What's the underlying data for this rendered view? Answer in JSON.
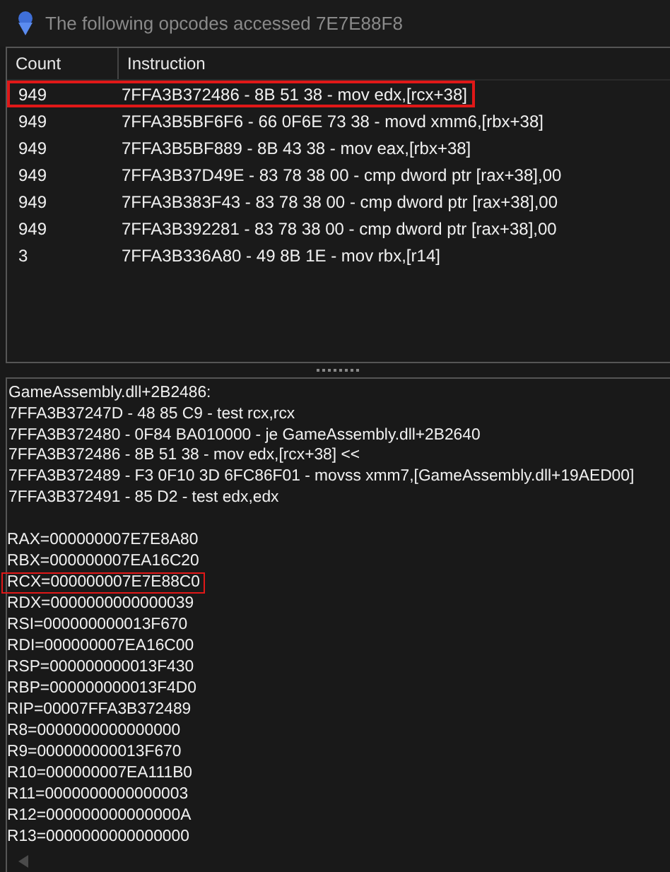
{
  "window": {
    "title": "The following opcodes accessed 7E7E88F8"
  },
  "table": {
    "columns": [
      "Count",
      "Instruction"
    ],
    "rows": [
      {
        "count": "949",
        "instruction": "7FFA3B372486 - 8B 51 38  - mov edx,[rcx+38]",
        "highlighted": true
      },
      {
        "count": "949",
        "instruction": "7FFA3B5BF6F6 - 66 0F6E 73 38  - movd xmm6,[rbx+38]",
        "highlighted": false
      },
      {
        "count": "949",
        "instruction": "7FFA3B5BF889 - 8B 43 38  - mov eax,[rbx+38]",
        "highlighted": false
      },
      {
        "count": "949",
        "instruction": "7FFA3B37D49E - 83 78 38 00 - cmp dword ptr [rax+38],00",
        "highlighted": false
      },
      {
        "count": "949",
        "instruction": "7FFA3B383F43 - 83 78 38 00 - cmp dword ptr [rax+38],00",
        "highlighted": false
      },
      {
        "count": "949",
        "instruction": "7FFA3B392281 - 83 78 38 00 - cmp dword ptr [rax+38],00",
        "highlighted": false
      },
      {
        "count": "3",
        "instruction": "7FFA3B336A80 - 49 8B 1E  - mov rbx,[r14]",
        "highlighted": false
      }
    ]
  },
  "details": {
    "disassembly": [
      "GameAssembly.dll+2B2486:",
      "7FFA3B37247D - 48 85 C9  - test rcx,rcx",
      "7FFA3B372480 - 0F84 BA010000 - je GameAssembly.dll+2B2640",
      "7FFA3B372486 - 8B 51 38  - mov edx,[rcx+38] <<",
      "7FFA3B372489 - F3 0F10 3D 6FC86F01  - movss xmm7,[GameAssembly.dll+19AED00]",
      "7FFA3B372491 - 85 D2  - test edx,edx"
    ],
    "registers": [
      {
        "text": "RAX=000000007E7E8A80",
        "highlighted": false
      },
      {
        "text": "RBX=000000007EA16C20",
        "highlighted": false
      },
      {
        "text": "RCX=000000007E7E88C0",
        "highlighted": true
      },
      {
        "text": "RDX=0000000000000039",
        "highlighted": false
      },
      {
        "text": "RSI=000000000013F670",
        "highlighted": false
      },
      {
        "text": "RDI=000000007EA16C00",
        "highlighted": false
      },
      {
        "text": "RSP=000000000013F430",
        "highlighted": false
      },
      {
        "text": "RBP=000000000013F4D0",
        "highlighted": false
      },
      {
        "text": "RIP=00007FFA3B372489",
        "highlighted": false
      },
      {
        "text": "R8=0000000000000000",
        "highlighted": false
      },
      {
        "text": "R9=000000000013F670",
        "highlighted": false
      },
      {
        "text": "R10=000000007EA111B0",
        "highlighted": false
      },
      {
        "text": "R11=0000000000000003",
        "highlighted": false
      },
      {
        "text": "R12=000000000000000A",
        "highlighted": false
      },
      {
        "text": "R13=0000000000000000",
        "highlighted": false
      }
    ]
  }
}
